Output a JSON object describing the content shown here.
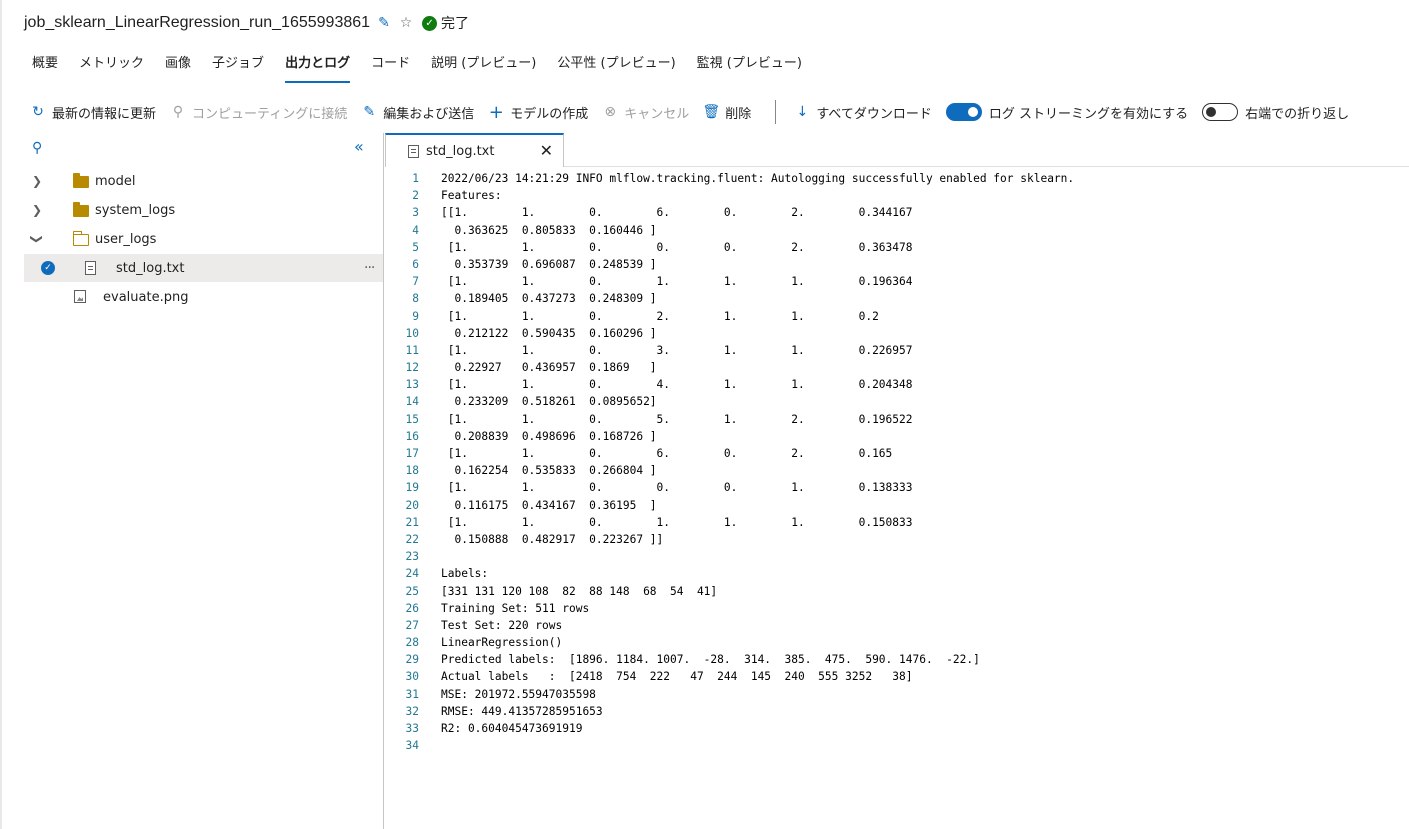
{
  "header": {
    "job_name": "job_sklearn_LinearRegression_run_1655993861",
    "status": "完了"
  },
  "tabs": [
    {
      "label": "概要"
    },
    {
      "label": "メトリック"
    },
    {
      "label": "画像"
    },
    {
      "label": "子ジョブ"
    },
    {
      "label": "出力とログ",
      "active": true
    },
    {
      "label": "コード"
    },
    {
      "label": "説明 (プレビュー)"
    },
    {
      "label": "公平性 (プレビュー)"
    },
    {
      "label": "監視 (プレビュー)"
    }
  ],
  "toolbar": {
    "refresh": "最新の情報に更新",
    "connect_compute": "コンピューティングに接続",
    "edit_submit": "編集および送信",
    "create_model": "モデルの作成",
    "cancel": "キャンセル",
    "delete": "削除",
    "download_all": "すべてダウンロード",
    "log_streaming": "ログ ストリーミングを有効にする",
    "log_streaming_on": true,
    "wrap": "右端での折り返し",
    "wrap_on": false
  },
  "tree": {
    "items": [
      {
        "label": "model",
        "type": "folder"
      },
      {
        "label": "system_logs",
        "type": "folder"
      },
      {
        "label": "user_logs",
        "type": "folder-open"
      },
      {
        "label": "std_log.txt",
        "type": "file",
        "selected": true
      },
      {
        "label": "evaluate.png",
        "type": "image"
      }
    ]
  },
  "editor": {
    "tab_label": "std_log.txt",
    "lines": [
      "2022/06/23 14:21:29 INFO mlflow.tracking.fluent: Autologging successfully enabled for sklearn.",
      "Features:",
      "[[1.        1.        0.        6.        0.        2.        0.344167",
      "  0.363625  0.805833  0.160446 ]",
      " [1.        1.        0.        0.        0.        2.        0.363478",
      "  0.353739  0.696087  0.248539 ]",
      " [1.        1.        0.        1.        1.        1.        0.196364",
      "  0.189405  0.437273  0.248309 ]",
      " [1.        1.        0.        2.        1.        1.        0.2",
      "  0.212122  0.590435  0.160296 ]",
      " [1.        1.        0.        3.        1.        1.        0.226957",
      "  0.22927   0.436957  0.1869   ]",
      " [1.        1.        0.        4.        1.        1.        0.204348",
      "  0.233209  0.518261  0.0895652]",
      " [1.        1.        0.        5.        1.        2.        0.196522",
      "  0.208839  0.498696  0.168726 ]",
      " [1.        1.        0.        6.        0.        2.        0.165",
      "  0.162254  0.535833  0.266804 ]",
      " [1.        1.        0.        0.        0.        1.        0.138333",
      "  0.116175  0.434167  0.36195  ]",
      " [1.        1.        0.        1.        1.        1.        0.150833",
      "  0.150888  0.482917  0.223267 ]]",
      "",
      "Labels:",
      "[331 131 120 108  82  88 148  68  54  41]",
      "Training Set: 511 rows",
      "Test Set: 220 rows",
      "LinearRegression()",
      "Predicted labels:  [1896. 1184. 1007.  -28.  314.  385.  475.  590. 1476.  -22.]",
      "Actual labels   :  [2418  754  222   47  244  145  240  555 3252   38]",
      "MSE: 201972.55947035598",
      "RMSE: 449.41357285951653",
      "R2: 0.604045473691919",
      ""
    ]
  }
}
